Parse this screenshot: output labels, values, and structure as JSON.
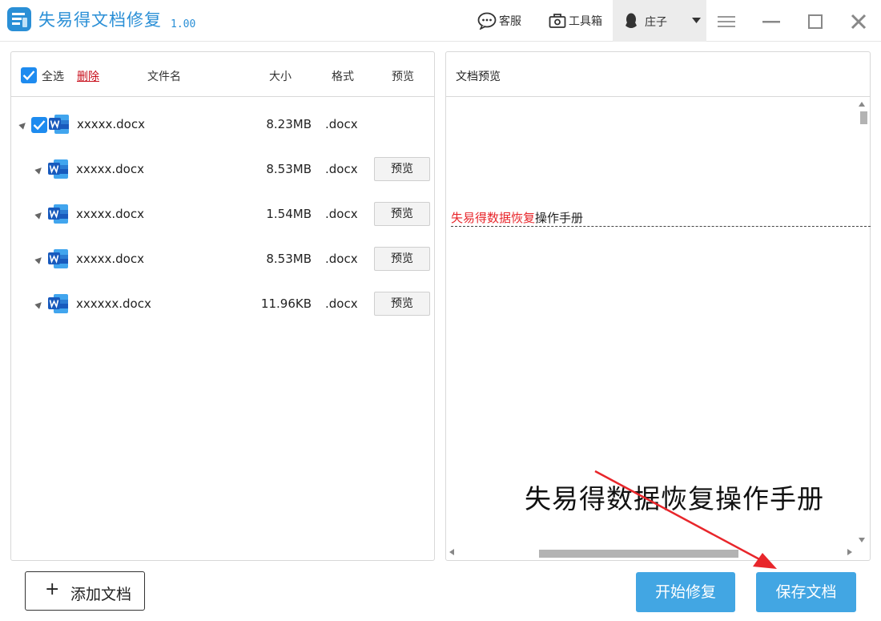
{
  "app": {
    "title": "失易得文档修复",
    "version": "1.00",
    "brand_color": "#2a8fd6"
  },
  "toolbar": {
    "support_label": "客服",
    "toolbox_label": "工具箱",
    "user_name": "庄子"
  },
  "file_list": {
    "select_all_label": "全选",
    "delete_label": "删除",
    "columns": {
      "name": "文件名",
      "size": "大小",
      "format": "格式",
      "preview": "预览"
    },
    "rows": [
      {
        "name": "xxxxx.docx",
        "size": "8.23MB",
        "format": ".docx",
        "preview_label": "",
        "checked": true
      },
      {
        "name": "xxxxx.docx",
        "size": "8.53MB",
        "format": ".docx",
        "preview_label": "预览",
        "checked": false
      },
      {
        "name": "xxxxx.docx",
        "size": "1.54MB",
        "format": ".docx",
        "preview_label": "预览",
        "checked": false
      },
      {
        "name": "xxxxx.docx",
        "size": "8.53MB",
        "format": ".docx",
        "preview_label": "预览",
        "checked": false
      },
      {
        "name": "xxxxxx.docx",
        "size": "11.96KB",
        "format": ".docx",
        "preview_label": "预览",
        "checked": false
      }
    ]
  },
  "preview": {
    "title": "文档预览",
    "doc_red": "失易得数据恢复",
    "doc_black": "操作手册"
  },
  "caption": "失易得数据恢复操作手册",
  "buttons": {
    "add": "添加文档",
    "start": "开始修复",
    "save": "保存文档"
  },
  "colors": {
    "accent_blue": "#42a6e3",
    "check_blue": "#1e8bef",
    "delete_red": "#c8101c",
    "highlight_red": "#e8262b",
    "arrow_red": "#e8262b"
  }
}
